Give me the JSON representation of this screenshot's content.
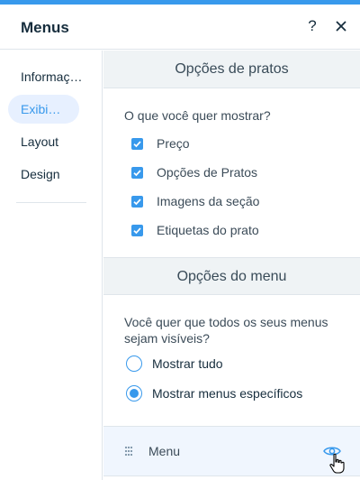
{
  "header": {
    "title": "Menus",
    "help_label": "?"
  },
  "sidebar": {
    "items": [
      {
        "label": "Informações"
      },
      {
        "label": "Exibição",
        "active": true
      },
      {
        "label": "Layout"
      },
      {
        "label": "Design"
      }
    ]
  },
  "dish_options": {
    "header": "Opções de pratos",
    "question": "O que você quer mostrar?",
    "checkboxes": [
      {
        "label": "Preço",
        "checked": true
      },
      {
        "label": "Opções de Pratos",
        "checked": true
      },
      {
        "label": "Imagens da seção",
        "checked": true
      },
      {
        "label": "Etiquetas do prato",
        "checked": true
      }
    ]
  },
  "menu_options": {
    "header": "Opções do menu",
    "question": "Você quer que todos os seus menus sejam visíveis?",
    "radios": [
      {
        "label": "Mostrar tudo",
        "selected": false
      },
      {
        "label": "Mostrar menus específicos",
        "selected": true
      }
    ]
  },
  "menu_list": {
    "items": [
      {
        "name": "Menu"
      }
    ]
  },
  "colors": {
    "accent": "#3899ec",
    "active_nav_bg": "#e7f0ff",
    "section_bg": "#eff3f5",
    "text_dark": "#162d3d"
  },
  "icons": {
    "help": "question-mark-icon",
    "close": "close-icon",
    "drag": "drag-handle-icon",
    "visibility": "eye-icon",
    "pointer": "hand-pointer-icon"
  }
}
